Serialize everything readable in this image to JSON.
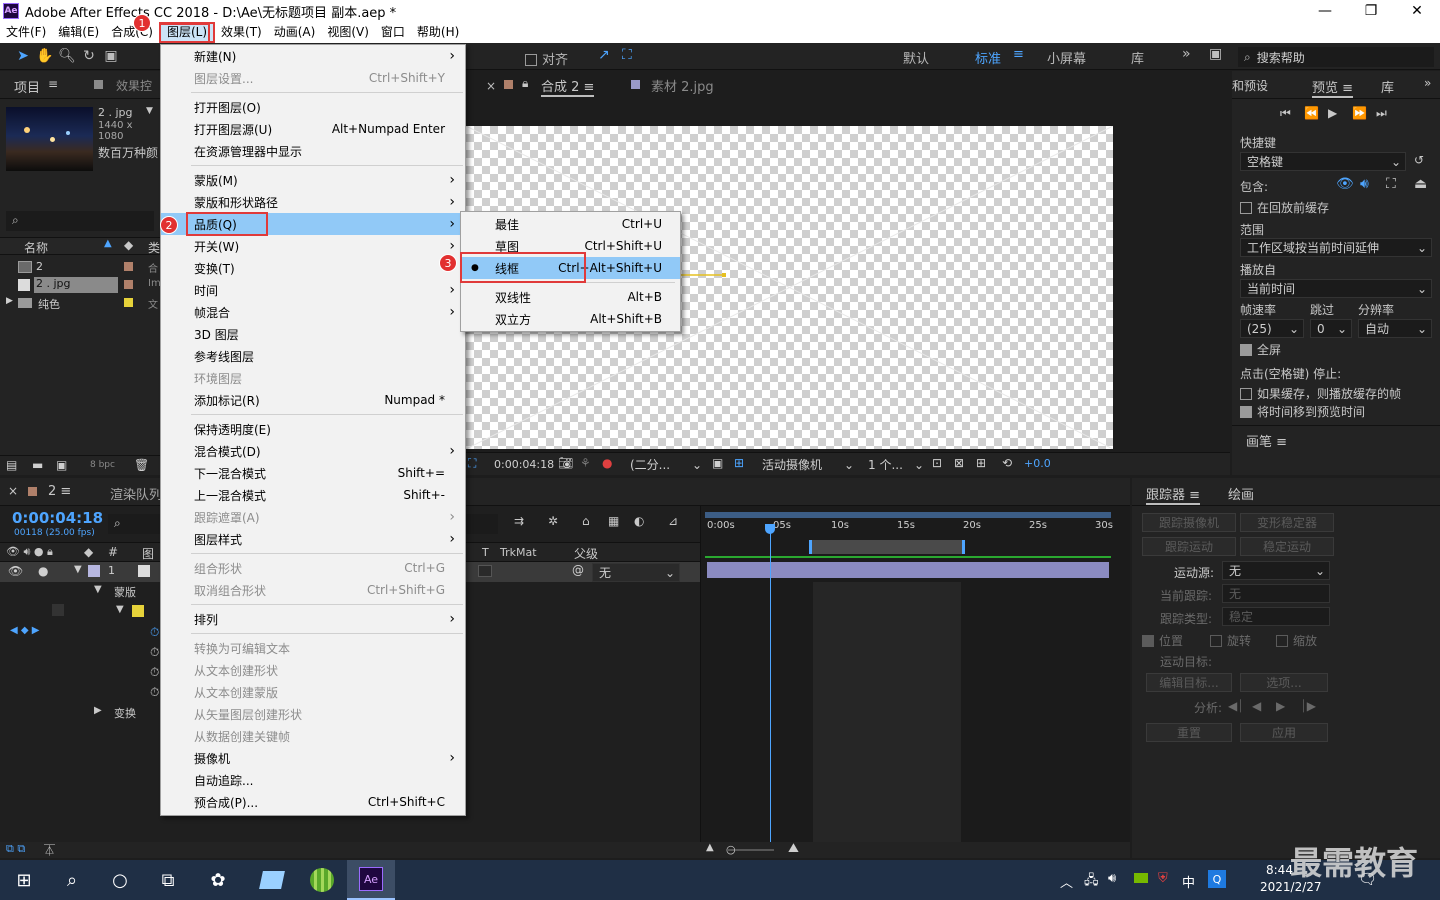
{
  "window": {
    "title": "Adobe After Effects CC 2018 - D:\\Ae\\无标题项目 副本.aep *",
    "logo": "Ae"
  },
  "menubar": {
    "items": [
      "文件(F)",
      "编辑(E)",
      "合成(C)",
      "图层(L)",
      "效果(T)",
      "动画(A)",
      "视图(V)",
      "窗口",
      "帮助(H)"
    ],
    "active_index": 3
  },
  "toolbar": {
    "align_label": "对齐",
    "workspaces": [
      "默认",
      "标准",
      "小屏幕",
      "库"
    ],
    "active_workspace": "标准",
    "search_placeholder": "搜索帮助"
  },
  "project_panel": {
    "tab_project": "项目",
    "tab_effects": "效果控",
    "preview_name": "2 . jpg",
    "preview_dims": "1440 x 1080",
    "preview_desc": "数百万种颜",
    "col_name": "名称",
    "col_type": "类",
    "items": [
      {
        "name": "2",
        "type": "合"
      },
      {
        "name": "2 . jpg",
        "type": "Im"
      },
      {
        "name": "纯色",
        "type": "文"
      }
    ],
    "bpc": "8 bpc"
  },
  "comp_panel": {
    "tab_comp": "合成 2",
    "tab_footage": "素材 2.jpg",
    "timecode": "0:00:04:18",
    "resolution": "(二分...",
    "camera": "活动摄像机",
    "views": "1 个...",
    "exposure": "+0.0"
  },
  "layer_menu": {
    "items": [
      {
        "label": "新建(N)",
        "shortcut": "",
        "submenu": true,
        "disabled": false
      },
      {
        "label": "图层设置...",
        "shortcut": "Ctrl+Shift+Y",
        "submenu": false,
        "disabled": true
      },
      {
        "label": "打开图层(O)",
        "shortcut": "",
        "submenu": false,
        "disabled": false
      },
      {
        "label": "打开图层源(U)",
        "shortcut": "Alt+Numpad Enter",
        "submenu": false,
        "disabled": false
      },
      {
        "label": "在资源管理器中显示",
        "shortcut": "",
        "submenu": false,
        "disabled": false
      },
      {
        "label": "蒙版(M)",
        "shortcut": "",
        "submenu": true,
        "disabled": false
      },
      {
        "label": "蒙版和形状路径",
        "shortcut": "",
        "submenu": true,
        "disabled": false
      },
      {
        "label": "品质(Q)",
        "shortcut": "",
        "submenu": true,
        "disabled": false
      },
      {
        "label": "开关(W)",
        "shortcut": "",
        "submenu": true,
        "disabled": false
      },
      {
        "label": "变换(T)",
        "shortcut": "",
        "submenu": true,
        "disabled": false
      },
      {
        "label": "时间",
        "shortcut": "",
        "submenu": true,
        "disabled": false
      },
      {
        "label": "帧混合",
        "shortcut": "",
        "submenu": true,
        "disabled": false
      },
      {
        "label": "3D 图层",
        "shortcut": "",
        "submenu": false,
        "disabled": false
      },
      {
        "label": "参考线图层",
        "shortcut": "",
        "submenu": false,
        "disabled": false
      },
      {
        "label": "环境图层",
        "shortcut": "",
        "submenu": false,
        "disabled": true
      },
      {
        "label": "添加标记(R)",
        "shortcut": "Numpad *",
        "submenu": false,
        "disabled": false
      },
      {
        "label": "保持透明度(E)",
        "shortcut": "",
        "submenu": false,
        "disabled": false
      },
      {
        "label": "混合模式(D)",
        "shortcut": "",
        "submenu": true,
        "disabled": false
      },
      {
        "label": "下一混合模式",
        "shortcut": "Shift+=",
        "submenu": false,
        "disabled": false
      },
      {
        "label": "上一混合模式",
        "shortcut": "Shift+-",
        "submenu": false,
        "disabled": false
      },
      {
        "label": "跟踪遮罩(A)",
        "shortcut": "",
        "submenu": true,
        "disabled": true
      },
      {
        "label": "图层样式",
        "shortcut": "",
        "submenu": true,
        "disabled": false
      },
      {
        "label": "组合形状",
        "shortcut": "Ctrl+G",
        "submenu": false,
        "disabled": true
      },
      {
        "label": "取消组合形状",
        "shortcut": "Ctrl+Shift+G",
        "submenu": false,
        "disabled": true
      },
      {
        "label": "排列",
        "shortcut": "",
        "submenu": true,
        "disabled": false
      },
      {
        "label": "转换为可编辑文本",
        "shortcut": "",
        "submenu": false,
        "disabled": true
      },
      {
        "label": "从文本创建形状",
        "shortcut": "",
        "submenu": false,
        "disabled": true
      },
      {
        "label": "从文本创建蒙版",
        "shortcut": "",
        "submenu": false,
        "disabled": true
      },
      {
        "label": "从矢量图层创建形状",
        "shortcut": "",
        "submenu": false,
        "disabled": true
      },
      {
        "label": "从数据创建关键帧",
        "shortcut": "",
        "submenu": false,
        "disabled": true
      },
      {
        "label": "摄像机",
        "shortcut": "",
        "submenu": true,
        "disabled": false
      },
      {
        "label": "自动追踪...",
        "shortcut": "",
        "submenu": false,
        "disabled": false
      },
      {
        "label": "预合成(P)...",
        "shortcut": "Ctrl+Shift+C",
        "submenu": false,
        "disabled": false
      }
    ]
  },
  "quality_menu": {
    "items": [
      {
        "label": "最佳",
        "shortcut": "Ctrl+U",
        "checked": false
      },
      {
        "label": "草图",
        "shortcut": "Ctrl+Shift+U",
        "checked": false
      },
      {
        "label": "线框",
        "shortcut": "Ctrl+Alt+Shift+U",
        "checked": true
      },
      {
        "label": "双线性",
        "shortcut": "Alt+B",
        "checked": false
      },
      {
        "label": "双立方",
        "shortcut": "Alt+Shift+B",
        "checked": false
      }
    ]
  },
  "badges": [
    "1",
    "2",
    "3"
  ],
  "preview_panel": {
    "tab_info": "和预设",
    "tab_preview": "预览",
    "tab_library": "库",
    "shortcut_label": "快捷键",
    "shortcut_value": "空格键",
    "include_label": "包含:",
    "cache_before": "在回放前缓存",
    "range_label": "范围",
    "range_value": "工作区域按当前时间延伸",
    "play_from_label": "播放自",
    "play_from_value": "当前时间",
    "fps_label": "帧速率",
    "skip_label": "跳过",
    "res_label": "分辨率",
    "fps_value": "(25)",
    "skip_value": "0",
    "res_value": "自动",
    "fullscreen": "全屏",
    "stop_label": "点击(空格键) 停止:",
    "if_cached": "如果缓存，则播放缓存的帧",
    "move_time": "将时间移到预览时间",
    "brush_tab": "画笔"
  },
  "timeline": {
    "comp_tab": "2",
    "render_tab": "渲染队列",
    "timecode": "0:00:04:18",
    "frames": "00118 (25.00 fps)",
    "col_source": "图",
    "col_trkmat": "TrkMat",
    "col_parent": "父级",
    "parent_value": "无",
    "layer_num": "1",
    "row_mask": "蒙版",
    "row_transform": "变换",
    "ruler": [
      "0:00s",
      "05s",
      "10s",
      "15s",
      "20s",
      "25s",
      "30s"
    ]
  },
  "tracker_panel": {
    "tab_tracker": "跟踪器",
    "tab_paint": "绘画",
    "track_camera": "跟踪摄像机",
    "warp_stabilizer": "变形稳定器",
    "track_motion": "跟踪运动",
    "stabilize_motion": "稳定运动",
    "motion_source_label": "运动源:",
    "motion_source_value": "无",
    "current_track_label": "当前跟踪:",
    "current_track_value": "无",
    "track_type_label": "跟踪类型:",
    "track_type_value": "稳定",
    "position": "位置",
    "rotation": "旋转",
    "scale": "缩放",
    "motion_target": "运动目标:",
    "edit_target": "编辑目标...",
    "options": "选项...",
    "analyze": "分析:",
    "reset": "重置",
    "apply": "应用"
  },
  "taskbar": {
    "time": "8:44",
    "date": "2021/2/27",
    "ime": "中",
    "watermark": "最需教育"
  },
  "colors": {
    "accent": "#4ea5ff",
    "highlight": "#91c9f7",
    "callout": "#e03a3a",
    "menu_bg": "#f2f2f2",
    "panel_bg": "#232323"
  }
}
